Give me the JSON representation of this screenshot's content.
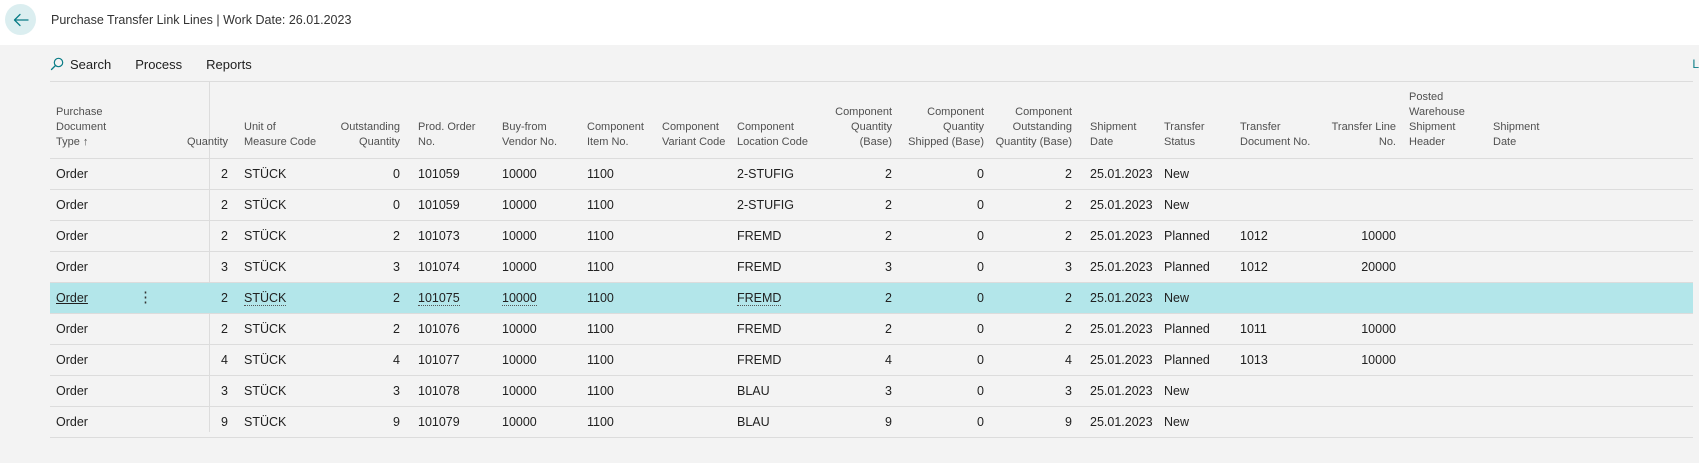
{
  "window": {
    "title": "Purchase Transfer Link Lines | Work Date: 26.01.2023",
    "edge_label": "L"
  },
  "actions": [
    {
      "label": "Search",
      "icon": "search-icon"
    },
    {
      "label": "Process"
    },
    {
      "label": "Reports"
    }
  ],
  "table": {
    "columns": [
      {
        "key": "doc_type",
        "label": "Purchase Document Type ↑",
        "align": "left"
      },
      {
        "key": "quantity",
        "label": "Quantity",
        "align": "right"
      },
      {
        "key": "uom",
        "label": "Unit of Measure Code",
        "align": "left"
      },
      {
        "key": "outstanding",
        "label": "Outstanding Quantity",
        "align": "right"
      },
      {
        "key": "prod_order",
        "label": "Prod. Order No.",
        "align": "left"
      },
      {
        "key": "vendor",
        "label": "Buy-from Vendor No.",
        "align": "left"
      },
      {
        "key": "comp_item",
        "label": "Component Item No.",
        "align": "left"
      },
      {
        "key": "comp_variant",
        "label": "Component Variant Code",
        "align": "left"
      },
      {
        "key": "comp_location",
        "label": "Component Location Code",
        "align": "left"
      },
      {
        "key": "comp_qty_base",
        "label": "Component Quantity (Base)",
        "align": "right"
      },
      {
        "key": "comp_qty_shipped",
        "label": "Component Quantity Shipped (Base)",
        "align": "right"
      },
      {
        "key": "comp_outstanding",
        "label": "Component Outstanding Quantity (Base)",
        "align": "right"
      },
      {
        "key": "ship_date",
        "label": "Shipment Date",
        "align": "left"
      },
      {
        "key": "transfer_status",
        "label": "Transfer Status",
        "align": "left"
      },
      {
        "key": "transfer_doc",
        "label": "Transfer Document No.",
        "align": "left"
      },
      {
        "key": "transfer_line",
        "label": "Transfer Line No.",
        "align": "right"
      },
      {
        "key": "posted_wh",
        "label": "Posted Warehouse Shipment Header",
        "align": "left"
      },
      {
        "key": "ship_date2",
        "label": "Shipment Date",
        "align": "left"
      }
    ],
    "rows": [
      [
        "Order",
        "2",
        "STÜCK",
        "0",
        "101059",
        "10000",
        "1100",
        "",
        "2-STUFIG",
        "2",
        "0",
        "2",
        "25.01.2023",
        "New",
        "",
        "",
        "",
        ""
      ],
      [
        "Order",
        "2",
        "STÜCK",
        "0",
        "101059",
        "10000",
        "1100",
        "",
        "2-STUFIG",
        "2",
        "0",
        "2",
        "25.01.2023",
        "New",
        "",
        "",
        "",
        ""
      ],
      [
        "Order",
        "2",
        "STÜCK",
        "2",
        "101073",
        "10000",
        "1100",
        "",
        "FREMD",
        "2",
        "0",
        "2",
        "25.01.2023",
        "Planned",
        "1012",
        "10000",
        "",
        ""
      ],
      [
        "Order",
        "3",
        "STÜCK",
        "3",
        "101074",
        "10000",
        "1100",
        "",
        "FREMD",
        "3",
        "0",
        "3",
        "25.01.2023",
        "Planned",
        "1012",
        "20000",
        "",
        ""
      ],
      [
        "Order",
        "2",
        "STÜCK",
        "2",
        "101075",
        "10000",
        "1100",
        "",
        "FREMD",
        "2",
        "0",
        "2",
        "25.01.2023",
        "New",
        "",
        "",
        "",
        ""
      ],
      [
        "Order",
        "2",
        "STÜCK",
        "2",
        "101076",
        "10000",
        "1100",
        "",
        "FREMD",
        "2",
        "0",
        "2",
        "25.01.2023",
        "Planned",
        "1011",
        "10000",
        "",
        ""
      ],
      [
        "Order",
        "4",
        "STÜCK",
        "4",
        "101077",
        "10000",
        "1100",
        "",
        "FREMD",
        "4",
        "0",
        "4",
        "25.01.2023",
        "Planned",
        "1013",
        "10000",
        "",
        ""
      ],
      [
        "Order",
        "3",
        "STÜCK",
        "3",
        "101078",
        "10000",
        "1100",
        "",
        "BLAU",
        "3",
        "0",
        "3",
        "25.01.2023",
        "New",
        "",
        "",
        "",
        ""
      ],
      [
        "Order",
        "9",
        "STÜCK",
        "9",
        "101079",
        "10000",
        "1100",
        "",
        "BLAU",
        "9",
        "0",
        "9",
        "25.01.2023",
        "New",
        "",
        "",
        "",
        ""
      ]
    ],
    "selected_row": 4,
    "selected_row_menu": "⋮"
  },
  "colors": {
    "accent": "#0a7c86",
    "selected_row": "#b3e6ea",
    "back_button_bg": "#dbeef0"
  }
}
